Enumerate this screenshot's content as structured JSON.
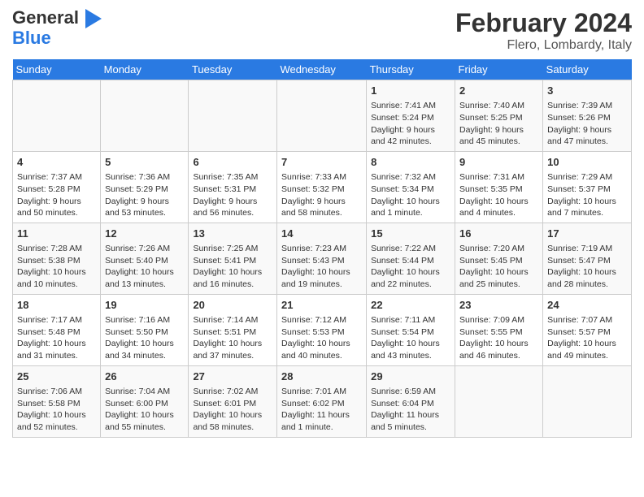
{
  "header": {
    "logo_line1": "General",
    "logo_line2": "Blue",
    "title": "February 2024",
    "subtitle": "Flero, Lombardy, Italy"
  },
  "weekdays": [
    "Sunday",
    "Monday",
    "Tuesday",
    "Wednesday",
    "Thursday",
    "Friday",
    "Saturday"
  ],
  "weeks": [
    [
      {
        "day": "",
        "info": ""
      },
      {
        "day": "",
        "info": ""
      },
      {
        "day": "",
        "info": ""
      },
      {
        "day": "",
        "info": ""
      },
      {
        "day": "1",
        "info": "Sunrise: 7:41 AM\nSunset: 5:24 PM\nDaylight: 9 hours and 42 minutes."
      },
      {
        "day": "2",
        "info": "Sunrise: 7:40 AM\nSunset: 5:25 PM\nDaylight: 9 hours and 45 minutes."
      },
      {
        "day": "3",
        "info": "Sunrise: 7:39 AM\nSunset: 5:26 PM\nDaylight: 9 hours and 47 minutes."
      }
    ],
    [
      {
        "day": "4",
        "info": "Sunrise: 7:37 AM\nSunset: 5:28 PM\nDaylight: 9 hours and 50 minutes."
      },
      {
        "day": "5",
        "info": "Sunrise: 7:36 AM\nSunset: 5:29 PM\nDaylight: 9 hours and 53 minutes."
      },
      {
        "day": "6",
        "info": "Sunrise: 7:35 AM\nSunset: 5:31 PM\nDaylight: 9 hours and 56 minutes."
      },
      {
        "day": "7",
        "info": "Sunrise: 7:33 AM\nSunset: 5:32 PM\nDaylight: 9 hours and 58 minutes."
      },
      {
        "day": "8",
        "info": "Sunrise: 7:32 AM\nSunset: 5:34 PM\nDaylight: 10 hours and 1 minute."
      },
      {
        "day": "9",
        "info": "Sunrise: 7:31 AM\nSunset: 5:35 PM\nDaylight: 10 hours and 4 minutes."
      },
      {
        "day": "10",
        "info": "Sunrise: 7:29 AM\nSunset: 5:37 PM\nDaylight: 10 hours and 7 minutes."
      }
    ],
    [
      {
        "day": "11",
        "info": "Sunrise: 7:28 AM\nSunset: 5:38 PM\nDaylight: 10 hours and 10 minutes."
      },
      {
        "day": "12",
        "info": "Sunrise: 7:26 AM\nSunset: 5:40 PM\nDaylight: 10 hours and 13 minutes."
      },
      {
        "day": "13",
        "info": "Sunrise: 7:25 AM\nSunset: 5:41 PM\nDaylight: 10 hours and 16 minutes."
      },
      {
        "day": "14",
        "info": "Sunrise: 7:23 AM\nSunset: 5:43 PM\nDaylight: 10 hours and 19 minutes."
      },
      {
        "day": "15",
        "info": "Sunrise: 7:22 AM\nSunset: 5:44 PM\nDaylight: 10 hours and 22 minutes."
      },
      {
        "day": "16",
        "info": "Sunrise: 7:20 AM\nSunset: 5:45 PM\nDaylight: 10 hours and 25 minutes."
      },
      {
        "day": "17",
        "info": "Sunrise: 7:19 AM\nSunset: 5:47 PM\nDaylight: 10 hours and 28 minutes."
      }
    ],
    [
      {
        "day": "18",
        "info": "Sunrise: 7:17 AM\nSunset: 5:48 PM\nDaylight: 10 hours and 31 minutes."
      },
      {
        "day": "19",
        "info": "Sunrise: 7:16 AM\nSunset: 5:50 PM\nDaylight: 10 hours and 34 minutes."
      },
      {
        "day": "20",
        "info": "Sunrise: 7:14 AM\nSunset: 5:51 PM\nDaylight: 10 hours and 37 minutes."
      },
      {
        "day": "21",
        "info": "Sunrise: 7:12 AM\nSunset: 5:53 PM\nDaylight: 10 hours and 40 minutes."
      },
      {
        "day": "22",
        "info": "Sunrise: 7:11 AM\nSunset: 5:54 PM\nDaylight: 10 hours and 43 minutes."
      },
      {
        "day": "23",
        "info": "Sunrise: 7:09 AM\nSunset: 5:55 PM\nDaylight: 10 hours and 46 minutes."
      },
      {
        "day": "24",
        "info": "Sunrise: 7:07 AM\nSunset: 5:57 PM\nDaylight: 10 hours and 49 minutes."
      }
    ],
    [
      {
        "day": "25",
        "info": "Sunrise: 7:06 AM\nSunset: 5:58 PM\nDaylight: 10 hours and 52 minutes."
      },
      {
        "day": "26",
        "info": "Sunrise: 7:04 AM\nSunset: 6:00 PM\nDaylight: 10 hours and 55 minutes."
      },
      {
        "day": "27",
        "info": "Sunrise: 7:02 AM\nSunset: 6:01 PM\nDaylight: 10 hours and 58 minutes."
      },
      {
        "day": "28",
        "info": "Sunrise: 7:01 AM\nSunset: 6:02 PM\nDaylight: 11 hours and 1 minute."
      },
      {
        "day": "29",
        "info": "Sunrise: 6:59 AM\nSunset: 6:04 PM\nDaylight: 11 hours and 5 minutes."
      },
      {
        "day": "",
        "info": ""
      },
      {
        "day": "",
        "info": ""
      }
    ]
  ]
}
